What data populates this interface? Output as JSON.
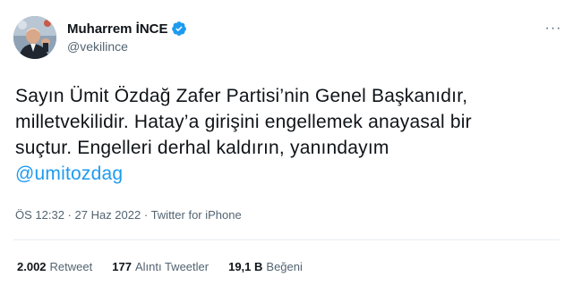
{
  "author": {
    "display_name": "Muharrem İNCE",
    "handle": "@vekilince",
    "verified": true,
    "avatar_icon": "profile-photo"
  },
  "tweet": {
    "lines": [
      "Sayın Ümit Özdağ Zafer Partisi’nin Genel Başkanıdır,",
      "milletvekilidir. Hatay’a girişini engellemek anayasal bir",
      "suçtur. Engelleri derhal kaldırın, yanındayım"
    ],
    "mention": "@umitozdag"
  },
  "meta": {
    "time": "ÖS 12:32",
    "separator": " · ",
    "date": "27 Haz 2022",
    "source": "Twitter for iPhone"
  },
  "stats": {
    "retweets": {
      "count": "2.002",
      "label": "Retweet"
    },
    "quotes": {
      "count": "177",
      "label": "Alıntı Tweetler"
    },
    "likes": {
      "count": "19,1 B",
      "label": "Beğeni"
    }
  },
  "more_icon": "ellipsis-icon",
  "colors": {
    "accent": "#1d9bf0",
    "text": "#0f1419",
    "secondary": "#536471",
    "divider": "#e6ecf0"
  }
}
